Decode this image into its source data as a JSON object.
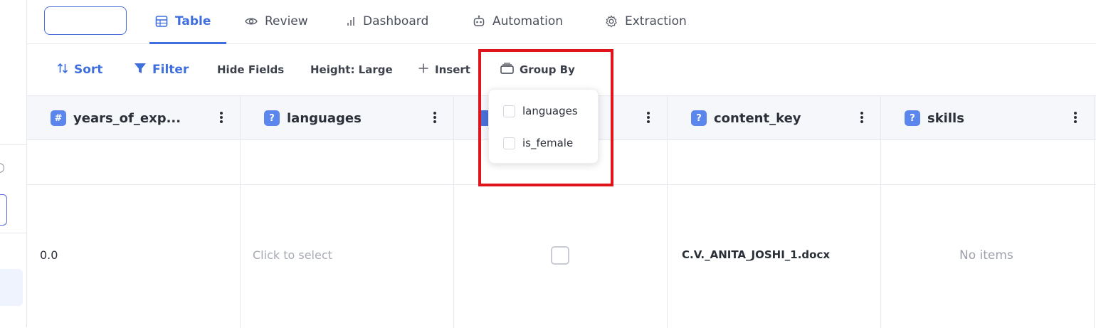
{
  "tabs": [
    {
      "label": "Table",
      "icon": "table-icon",
      "active": true
    },
    {
      "label": "Review",
      "icon": "eye-icon",
      "active": false
    },
    {
      "label": "Dashboard",
      "icon": "bar-chart-icon",
      "active": false
    },
    {
      "label": "Automation",
      "icon": "robot-icon",
      "active": false
    },
    {
      "label": "Extraction",
      "icon": "gear-icon",
      "active": false
    }
  ],
  "toolbar": {
    "sort": "Sort",
    "filter": "Filter",
    "hide_fields": "Hide Fields",
    "height": "Height: Large",
    "insert": "Insert",
    "group_by": "Group By"
  },
  "group_by_menu": {
    "options": [
      {
        "label": "languages",
        "checked": false
      },
      {
        "label": "is_female",
        "checked": false
      }
    ]
  },
  "columns": [
    {
      "name": "years_of_exp...",
      "type_icon": "#"
    },
    {
      "name": "languages",
      "type_icon": "?"
    },
    {
      "name": "",
      "type_icon": ""
    },
    {
      "name": "content_key",
      "type_icon": "?"
    },
    {
      "name": "skills",
      "type_icon": "?"
    }
  ],
  "rows": [
    {
      "years": "",
      "languages": "",
      "is_female": null,
      "content_key": "",
      "skills": ""
    },
    {
      "years": "0.0",
      "languages": "Click to select",
      "is_female": false,
      "content_key": "C.V._ANITA_JOSHI_1.docx",
      "skills": "No items"
    }
  ],
  "colors": {
    "accent": "#3f6fde",
    "highlight": "#e0141b",
    "badge": "#5b86ec"
  }
}
